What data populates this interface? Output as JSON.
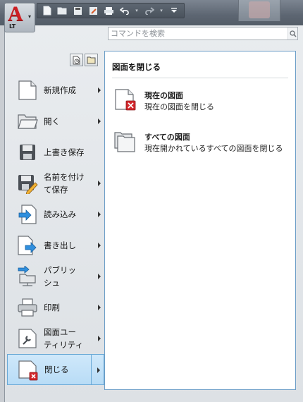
{
  "quick_access": {
    "buttons": [
      "new-icon",
      "open-icon",
      "save-icon",
      "save-as-icon",
      "plot-icon",
      "undo-icon",
      "redo-icon",
      "customize-icon"
    ]
  },
  "app_menu": {
    "logo_letter": "A",
    "edition": "LT"
  },
  "search": {
    "placeholder": "コマンドを検索"
  },
  "commands": [
    {
      "label": "新規作成",
      "icon": "new-drawing-icon",
      "submenu": true
    },
    {
      "label": "開く",
      "icon": "open-folder-icon",
      "submenu": true
    },
    {
      "label": "上書き保存",
      "icon": "save-icon",
      "submenu": false
    },
    {
      "label": "名前を付け\nて保存",
      "icon": "save-as-icon",
      "submenu": true
    },
    {
      "label": "読み込み",
      "icon": "import-icon",
      "submenu": true
    },
    {
      "label": "書き出し",
      "icon": "export-icon",
      "submenu": true
    },
    {
      "label": "パブリッ\nシュ",
      "icon": "publish-icon",
      "submenu": true
    },
    {
      "label": "印刷",
      "icon": "printer-icon",
      "submenu": true
    },
    {
      "label": "図面ユー\nティリティ",
      "icon": "drawing-utilities-icon",
      "submenu": true
    },
    {
      "label": "閉じる",
      "icon": "close-drawing-icon",
      "submenu": true,
      "active": true
    }
  ],
  "panel": {
    "title": "図面を閉じる",
    "options": [
      {
        "title": "現在の図面",
        "description": "現在の図面を閉じる",
        "icon": "close-current-drawing-icon"
      },
      {
        "title": "すべての図面",
        "description": "現在開かれているすべての図面を閉じる",
        "icon": "close-all-drawings-icon"
      }
    ]
  },
  "colors": {
    "accent_red": "#cf1f24",
    "highlight": "#b8dcf6",
    "panel_border": "#6b9dc7"
  }
}
